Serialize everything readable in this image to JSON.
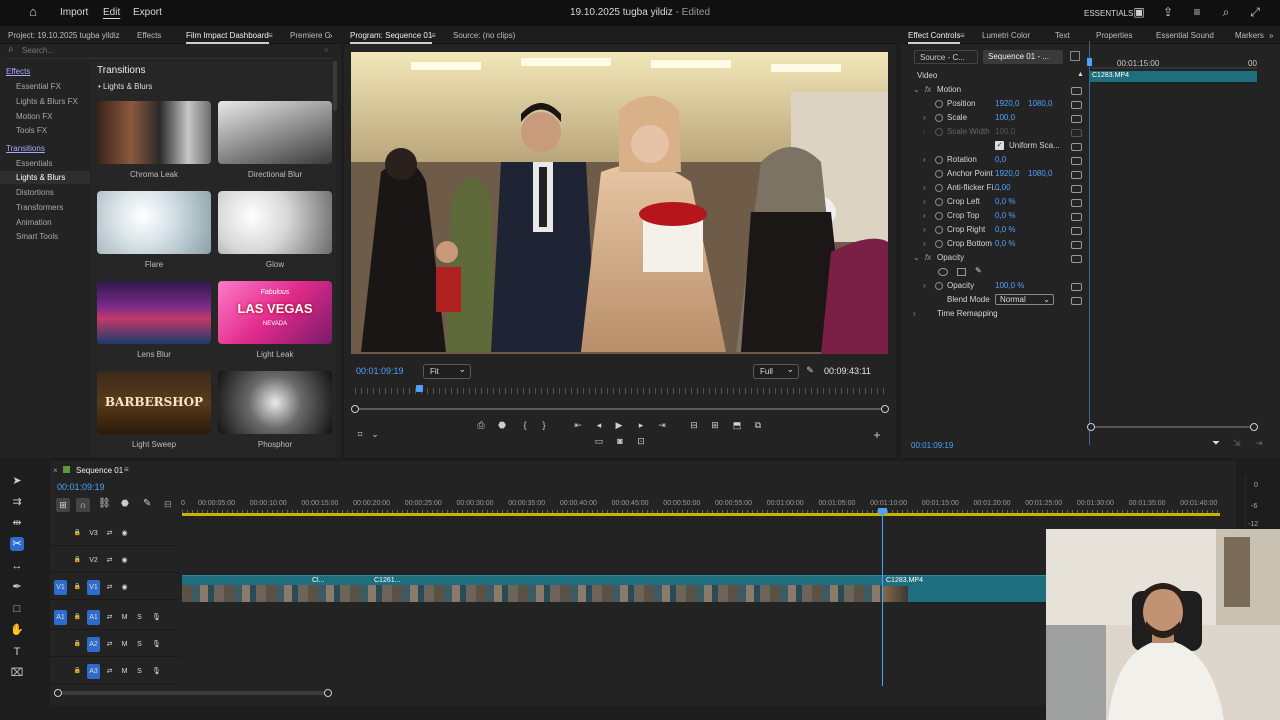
{
  "topbar": {
    "menu": [
      "Import",
      "Edit",
      "Export"
    ],
    "title": "19.10.2025 tugba yildiz",
    "status": " - Edited",
    "workspace": "ESSENTIALS"
  },
  "effects_panel": {
    "tabs": [
      "Project: 19.10.2025 tugba yildiz",
      "Effects",
      "Film Impact Dashboard",
      "Premiere C"
    ],
    "search_placeholder": "Search...",
    "tree": {
      "effects_header": "Effects",
      "effects_items": [
        "Essential FX",
        "Lights & Blurs FX",
        "Motion FX",
        "Tools FX"
      ],
      "transitions_header": "Transitions",
      "transitions_items": [
        "Essentials",
        "Lights & Blurs",
        "Distortions",
        "Transformers",
        "Animation",
        "Smart Tools"
      ]
    },
    "gallery_title": "Transitions",
    "gallery_subtitle": "Lights & Blurs",
    "thumbnails": [
      "Chroma Leak",
      "Directional Blur",
      "Flare",
      "Glow",
      "Lens Blur",
      "Light Leak",
      "Light Sweep",
      "Phosphor"
    ],
    "thumb_texts": {
      "light_leak_top": "Fabulous",
      "light_leak_main": "LAS VEGAS",
      "light_leak_sub": "NEVADA",
      "barbershop": "BARBERSHOP"
    }
  },
  "program_monitor": {
    "tabs": [
      "Program: Sequence 01",
      "Source: (no clips)"
    ],
    "current_time": "00:01:09:19",
    "zoom": "Fit",
    "resolution": "Full",
    "duration": "00:09:43:11",
    "playhead_progress": 0.12
  },
  "effect_controls": {
    "tabs": [
      "Effect Controls",
      "Lumetri Color",
      "Text",
      "Properties",
      "Essential Sound",
      "Markers"
    ],
    "source_label": "Source - C...",
    "sequence_label": "Sequence 01 - ...",
    "ruler_time": "00:01:15:00",
    "ruler_end": "00",
    "clip_name": "C1283.MP4",
    "section_video": "Video",
    "motion": "Motion",
    "position_label": "Position",
    "position_x": "1920,0",
    "position_y": "1080,0",
    "scale_label": "Scale",
    "scale": "100,0",
    "scale_width_label": "Scale Width",
    "scale_width": "100,0",
    "uniform_scale": "Uniform Sca...",
    "rotation_label": "Rotation",
    "rotation": "0,0",
    "anchor_label": "Anchor Point",
    "anchor_x": "1920,0",
    "anchor_y": "1080,0",
    "antiflicker_label": "Anti-flicker Fi...",
    "antiflicker": "0,00",
    "crop_left_label": "Crop Left",
    "crop_left": "0,0 %",
    "crop_top_label": "Crop Top",
    "crop_top": "0,0 %",
    "crop_right_label": "Crop Right",
    "crop_right": "0,0 %",
    "crop_bottom_label": "Crop Bottom",
    "crop_bottom": "0,0 %",
    "opacity_section": "Opacity",
    "opacity_label": "Opacity",
    "opacity": "100,0 %",
    "blend_label": "Blend Mode",
    "blend": "Normal",
    "time_remap": "Time Remapping",
    "footer_time": "00:01:09:19"
  },
  "timeline": {
    "sequence_tab": "Sequence 01",
    "current_time": "00:01:09:19",
    "ruler": [
      "0",
      "00:00:05:00",
      "00:00:10:00",
      "00:00:15:00",
      "00:00:20:00",
      "00:00:25:00",
      "00:00:30:00",
      "00:00:35:00",
      "00:00:40:00",
      "00:00:45:00",
      "00:00:50:00",
      "00:00:55:00",
      "00:01:00:00",
      "00:01:05:00",
      "00:01:10:00",
      "00:01:15:00",
      "00:01:20:00",
      "00:01:25:00",
      "00:01:30:00",
      "00:01:35:00",
      "00:01:40:00"
    ],
    "tracks": [
      "V3",
      "V2",
      "V1",
      "A1",
      "A2",
      "A3"
    ],
    "clips": [
      "Cl...",
      "C1261...",
      "C1283.MP4"
    ],
    "meter_labels": [
      "0",
      "-6",
      "-12"
    ]
  },
  "colors": {
    "accent_blue": "#4ea1ff",
    "clip_teal": "#1f6e7d",
    "audio_blue": "#2a5ea8"
  }
}
